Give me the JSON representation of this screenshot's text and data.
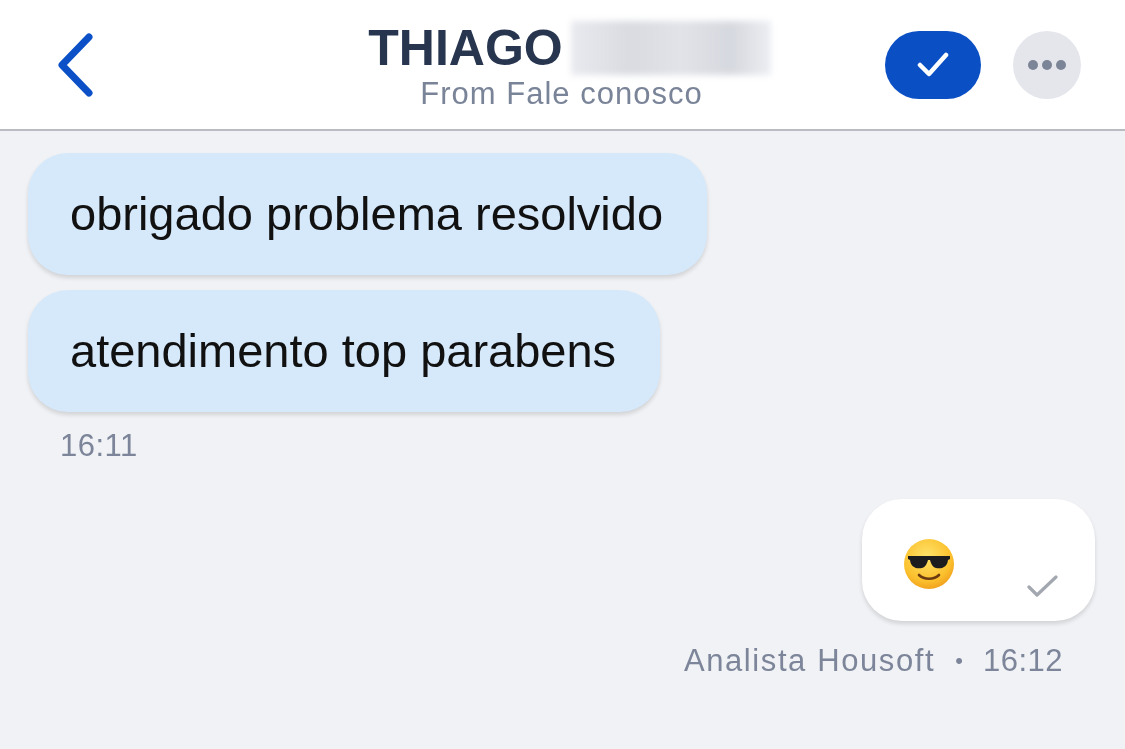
{
  "header": {
    "title": "THIAGO",
    "name_redacted": true,
    "subtitle": "From Fale conosco"
  },
  "message_groups": [
    {
      "outgoing": false,
      "messages": [
        {
          "kind": "text",
          "text": "obrigado problema resolvido"
        },
        {
          "kind": "text",
          "text": "atendimento top parabens"
        }
      ],
      "time": "16:11"
    },
    {
      "outgoing": true,
      "messages": [
        {
          "kind": "emoji",
          "sent": true
        }
      ],
      "sender": "Analista Housoft",
      "separator": "•",
      "time": "16:12"
    }
  ]
}
